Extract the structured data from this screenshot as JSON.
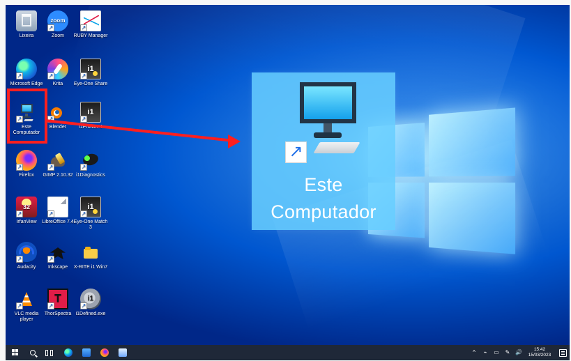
{
  "desktop": {
    "icons": [
      {
        "label": "Lixeira",
        "icon": "recycle-bin-icon",
        "badge": ""
      },
      {
        "label": "Zoom",
        "icon": "zoom-icon",
        "badge": "zoom"
      },
      {
        "label": "RUBY Manager",
        "icon": "chart-app-icon",
        "badge": ""
      },
      {
        "label": "Microsoft Edge",
        "icon": "microsoft-edge-icon",
        "badge": ""
      },
      {
        "label": "Krita",
        "icon": "krita-icon",
        "badge": ""
      },
      {
        "label": "Eye-One Share",
        "icon": "eye-one-share-icon",
        "badge": "i1"
      },
      {
        "label": "Este Computador",
        "icon": "computer-icon",
        "badge": ""
      },
      {
        "label": "Blender",
        "icon": "blender-icon",
        "badge": ""
      },
      {
        "label": "i1Profiler 4",
        "icon": "i1-profiler-icon",
        "badge": "i1"
      },
      {
        "label": "Firefox",
        "icon": "firefox-icon",
        "badge": ""
      },
      {
        "label": "GIMP 2.10.32",
        "icon": "gimp-icon",
        "badge": ""
      },
      {
        "label": "i1Diagnostics",
        "icon": "diagnostics-icon",
        "badge": ""
      },
      {
        "label": "IrfanView",
        "icon": "irfanview-icon",
        "badge": "32"
      },
      {
        "label": "LibreOffice 7.4",
        "icon": "document-icon",
        "badge": ""
      },
      {
        "label": "Eye-One Match 3",
        "icon": "eye-one-match-icon",
        "badge": "i1"
      },
      {
        "label": "Audacity",
        "icon": "audacity-icon",
        "badge": ""
      },
      {
        "label": "Inkscape",
        "icon": "inkscape-icon",
        "badge": ""
      },
      {
        "label": "X-RITE i1 Win7",
        "icon": "folder-icon",
        "badge": ""
      },
      {
        "label": "VLC media player",
        "icon": "vlc-icon",
        "badge": ""
      },
      {
        "label": "ThorSpectra",
        "icon": "thorspectra-icon",
        "badge": "T"
      },
      {
        "label": "i1Defined.exe",
        "icon": "i1defined-icon",
        "badge": "i1"
      }
    ],
    "zoomed_item": {
      "label": "Este Computador",
      "icon": "computer-icon"
    },
    "highlight_color": "#ff1f1f",
    "callout_bg": "#68ceff"
  },
  "taskbar": {
    "clock_time": "15:42",
    "clock_date": "15/03/2023",
    "start_icon": "windows-logo-icon",
    "search_icon": "search-icon",
    "task_view_icon": "task-view-icon",
    "pinned": [
      {
        "name": "edge",
        "icon": "microsoft-edge-icon"
      },
      {
        "name": "store",
        "icon": "store-icon"
      },
      {
        "name": "firefox",
        "icon": "firefox-icon"
      },
      {
        "name": "document",
        "icon": "document-icon"
      }
    ],
    "tray": {
      "chevron": "^",
      "icons": [
        "speaker-icon",
        "network-icon",
        "pen-icon",
        "volume-icon"
      ]
    }
  }
}
